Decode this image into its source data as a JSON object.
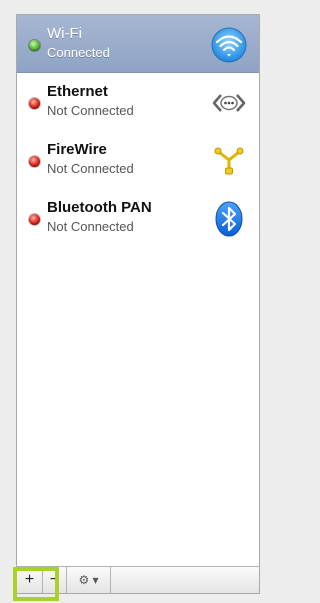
{
  "services": [
    {
      "name": "Wi-Fi",
      "status": "Connected",
      "status_color": "#55b531",
      "icon": "wifi-icon",
      "selected": true
    },
    {
      "name": "Ethernet",
      "status": "Not Connected",
      "status_color": "#dd1f14",
      "icon": "ethernet-icon",
      "selected": false
    },
    {
      "name": "FireWire",
      "status": "Not Connected",
      "status_color": "#dd1f14",
      "icon": "firewire-icon",
      "selected": false
    },
    {
      "name": "Bluetooth PAN",
      "status": "Not Connected",
      "status_color": "#dd1f14",
      "icon": "bluetooth-icon",
      "selected": false
    }
  ],
  "toolbar": {
    "add_label": "+",
    "remove_label": "−",
    "action_label": "⚙ ▾"
  },
  "colors": {
    "highlight": "#a7d22a",
    "selection": "#8ea3c4"
  }
}
